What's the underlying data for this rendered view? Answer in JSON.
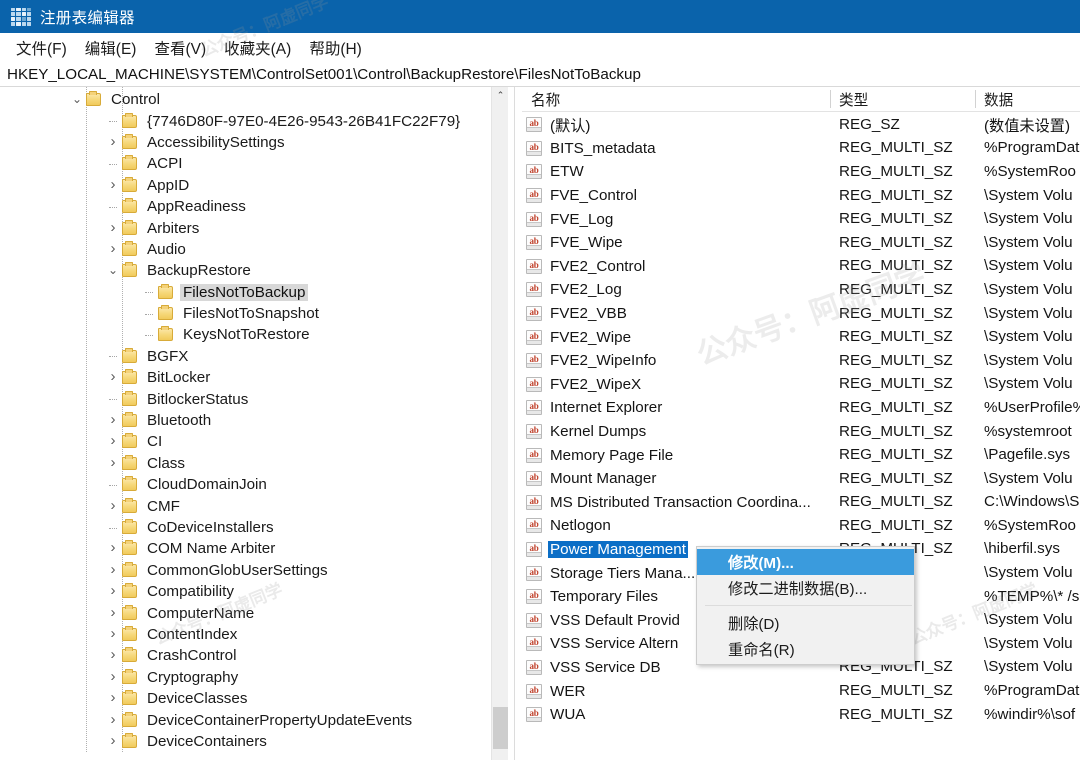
{
  "window": {
    "title": "注册表编辑器",
    "icon": "registry-editor-icon"
  },
  "menubar": {
    "items": [
      {
        "label": "文件(F)",
        "name": "menu-file"
      },
      {
        "label": "编辑(E)",
        "name": "menu-edit"
      },
      {
        "label": "查看(V)",
        "name": "menu-view"
      },
      {
        "label": "收藏夹(A)",
        "name": "menu-favorites"
      },
      {
        "label": "帮助(H)",
        "name": "menu-help"
      }
    ]
  },
  "address": {
    "path": "HKEY_LOCAL_MACHINE\\SYSTEM\\ControlSet001\\Control\\BackupRestore\\FilesNotToBackup"
  },
  "tree": {
    "scrollbar": {
      "up_arrow": "⌃"
    },
    "items": [
      {
        "label": "Control",
        "depth": 0,
        "twist": "expanded",
        "selected": false
      },
      {
        "label": "{7746D80F-97E0-4E26-9543-26B41FC22F79}",
        "depth": 1,
        "twist": "leaf",
        "selected": false
      },
      {
        "label": "AccessibilitySettings",
        "depth": 1,
        "twist": "collapsed",
        "selected": false
      },
      {
        "label": "ACPI",
        "depth": 1,
        "twist": "leaf",
        "selected": false
      },
      {
        "label": "AppID",
        "depth": 1,
        "twist": "collapsed",
        "selected": false
      },
      {
        "label": "AppReadiness",
        "depth": 1,
        "twist": "leaf",
        "selected": false
      },
      {
        "label": "Arbiters",
        "depth": 1,
        "twist": "collapsed",
        "selected": false
      },
      {
        "label": "Audio",
        "depth": 1,
        "twist": "collapsed",
        "selected": false
      },
      {
        "label": "BackupRestore",
        "depth": 1,
        "twist": "expanded",
        "selected": false
      },
      {
        "label": "FilesNotToBackup",
        "depth": 2,
        "twist": "leaf",
        "selected": true
      },
      {
        "label": "FilesNotToSnapshot",
        "depth": 2,
        "twist": "leaf",
        "selected": false
      },
      {
        "label": "KeysNotToRestore",
        "depth": 2,
        "twist": "leaf",
        "selected": false
      },
      {
        "label": "BGFX",
        "depth": 1,
        "twist": "leaf",
        "selected": false
      },
      {
        "label": "BitLocker",
        "depth": 1,
        "twist": "collapsed",
        "selected": false
      },
      {
        "label": "BitlockerStatus",
        "depth": 1,
        "twist": "leaf",
        "selected": false
      },
      {
        "label": "Bluetooth",
        "depth": 1,
        "twist": "collapsed",
        "selected": false
      },
      {
        "label": "CI",
        "depth": 1,
        "twist": "collapsed",
        "selected": false
      },
      {
        "label": "Class",
        "depth": 1,
        "twist": "collapsed",
        "selected": false
      },
      {
        "label": "CloudDomainJoin",
        "depth": 1,
        "twist": "leaf",
        "selected": false
      },
      {
        "label": "CMF",
        "depth": 1,
        "twist": "collapsed",
        "selected": false
      },
      {
        "label": "CoDeviceInstallers",
        "depth": 1,
        "twist": "leaf",
        "selected": false
      },
      {
        "label": "COM Name Arbiter",
        "depth": 1,
        "twist": "collapsed",
        "selected": false
      },
      {
        "label": "CommonGlobUserSettings",
        "depth": 1,
        "twist": "collapsed",
        "selected": false
      },
      {
        "label": "Compatibility",
        "depth": 1,
        "twist": "collapsed",
        "selected": false
      },
      {
        "label": "ComputerName",
        "depth": 1,
        "twist": "collapsed",
        "selected": false
      },
      {
        "label": "ContentIndex",
        "depth": 1,
        "twist": "collapsed",
        "selected": false
      },
      {
        "label": "CrashControl",
        "depth": 1,
        "twist": "collapsed",
        "selected": false
      },
      {
        "label": "Cryptography",
        "depth": 1,
        "twist": "collapsed",
        "selected": false
      },
      {
        "label": "DeviceClasses",
        "depth": 1,
        "twist": "collapsed",
        "selected": false
      },
      {
        "label": "DeviceContainerPropertyUpdateEvents",
        "depth": 1,
        "twist": "collapsed",
        "selected": false
      },
      {
        "label": "DeviceContainers",
        "depth": 1,
        "twist": "collapsed",
        "selected": false
      }
    ]
  },
  "list": {
    "columns": [
      {
        "label": "名称",
        "name": "column-name"
      },
      {
        "label": "类型",
        "name": "column-type"
      },
      {
        "label": "数据",
        "name": "column-data"
      }
    ],
    "rows": [
      {
        "name": "(默认)",
        "type": "REG_SZ",
        "data": "(数值未设置)",
        "selected": false
      },
      {
        "name": "BITS_metadata",
        "type": "REG_MULTI_SZ",
        "data": "%ProgramDat",
        "selected": false
      },
      {
        "name": "ETW",
        "type": "REG_MULTI_SZ",
        "data": "%SystemRoo",
        "selected": false
      },
      {
        "name": "FVE_Control",
        "type": "REG_MULTI_SZ",
        "data": "\\System Volu",
        "selected": false
      },
      {
        "name": "FVE_Log",
        "type": "REG_MULTI_SZ",
        "data": "\\System Volu",
        "selected": false
      },
      {
        "name": "FVE_Wipe",
        "type": "REG_MULTI_SZ",
        "data": "\\System Volu",
        "selected": false
      },
      {
        "name": "FVE2_Control",
        "type": "REG_MULTI_SZ",
        "data": "\\System Volu",
        "selected": false
      },
      {
        "name": "FVE2_Log",
        "type": "REG_MULTI_SZ",
        "data": "\\System Volu",
        "selected": false
      },
      {
        "name": "FVE2_VBB",
        "type": "REG_MULTI_SZ",
        "data": "\\System Volu",
        "selected": false
      },
      {
        "name": "FVE2_Wipe",
        "type": "REG_MULTI_SZ",
        "data": "\\System Volu",
        "selected": false
      },
      {
        "name": "FVE2_WipeInfo",
        "type": "REG_MULTI_SZ",
        "data": "\\System Volu",
        "selected": false
      },
      {
        "name": "FVE2_WipeX",
        "type": "REG_MULTI_SZ",
        "data": "\\System Volu",
        "selected": false
      },
      {
        "name": "Internet Explorer",
        "type": "REG_MULTI_SZ",
        "data": "%UserProfile%",
        "selected": false
      },
      {
        "name": "Kernel Dumps",
        "type": "REG_MULTI_SZ",
        "data": "%systemroot",
        "selected": false
      },
      {
        "name": "Memory Page File",
        "type": "REG_MULTI_SZ",
        "data": "\\Pagefile.sys",
        "selected": false
      },
      {
        "name": "Mount Manager",
        "type": "REG_MULTI_SZ",
        "data": "\\System Volu",
        "selected": false
      },
      {
        "name": "MS Distributed Transaction Coordina...",
        "type": "REG_MULTI_SZ",
        "data": "C:\\Windows\\S",
        "selected": false
      },
      {
        "name": "Netlogon",
        "type": "REG_MULTI_SZ",
        "data": "%SystemRoo",
        "selected": false
      },
      {
        "name": "Power Management",
        "type": "REG_MULTI_SZ",
        "data": "\\hiberfil.sys",
        "selected": true
      },
      {
        "name": "Storage Tiers Mana...",
        "type": "_SZ",
        "data": "\\System Volu",
        "selected": false
      },
      {
        "name": "Temporary Files",
        "type": "_SZ",
        "data": "%TEMP%\\* /s",
        "selected": false
      },
      {
        "name": "VSS Default Provid",
        "type": "_SZ",
        "data": "\\System Volu",
        "selected": false
      },
      {
        "name": "VSS Service Altern",
        "type": "_SZ",
        "data": "\\System Volu",
        "selected": false
      },
      {
        "name": "VSS Service DB",
        "type": "REG_MULTI_SZ",
        "data": "\\System Volu",
        "selected": false
      },
      {
        "name": "WER",
        "type": "REG_MULTI_SZ",
        "data": "%ProgramDat",
        "selected": false
      },
      {
        "name": "WUA",
        "type": "REG_MULTI_SZ",
        "data": "%windir%\\sof",
        "selected": false
      }
    ]
  },
  "context_menu": {
    "items": [
      {
        "label": "修改(M)...",
        "name": "ctx-modify",
        "highlighted": true,
        "separator_after": false
      },
      {
        "label": "修改二进制数据(B)...",
        "name": "ctx-modify-binary",
        "highlighted": false,
        "separator_after": true
      },
      {
        "label": "删除(D)",
        "name": "ctx-delete",
        "highlighted": false,
        "separator_after": false
      },
      {
        "label": "重命名(R)",
        "name": "ctx-rename",
        "highlighted": false,
        "separator_after": false
      }
    ]
  },
  "watermarks": [
    "公众号：阿虚同学",
    "公众号：阿虚同学",
    "公众号：阿虚同学",
    "公众号：阿虚同学"
  ],
  "colors": {
    "titlebar": "#0a63ab",
    "selection": "#0b6ec6",
    "menu_highlight": "#3a9bdd",
    "folder": "#f1ca5c"
  }
}
